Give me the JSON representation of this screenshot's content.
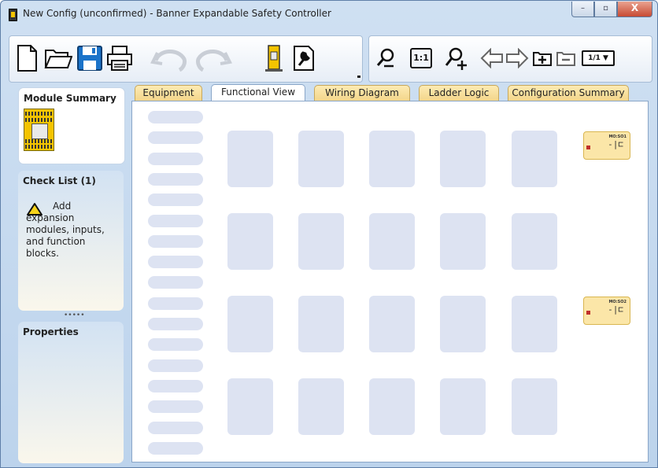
{
  "window": {
    "title": "New Config (unconfirmed) - Banner Expandable Safety Controller",
    "controls": {
      "minimize": "–",
      "maximize": "▫",
      "close": "X"
    }
  },
  "toolbar": {
    "zoom_actual_label": "1:1",
    "page_indicator": "1/1 ▼",
    "icons": [
      "new-file-icon",
      "open-folder-icon",
      "save-icon",
      "print-icon",
      "undo-icon",
      "redo-icon",
      "controller-icon",
      "wrench-icon",
      "zoom-out-icon",
      "zoom-actual-icon",
      "add-user-icon",
      "arrow-left-icon",
      "arrow-right-icon",
      "add-page-icon",
      "remove-page-icon",
      "page-selector"
    ]
  },
  "sidebar": {
    "module_summary_title": "Module Summary",
    "checklist_title": "Check List (1)",
    "checklist_item": "Add expansion modules, inputs, and function blocks.",
    "grip": "•••••",
    "properties_title": "Properties"
  },
  "tabs": [
    {
      "label": "Equipment",
      "active": false
    },
    {
      "label": "Functional View",
      "active": true
    },
    {
      "label": "Wiring Diagram",
      "active": false
    },
    {
      "label": "Ladder Logic",
      "active": false
    },
    {
      "label": "Configuration Summary",
      "active": false
    }
  ],
  "functional_view": {
    "outputs": [
      {
        "label": "MO:SO1",
        "symbol": "-|⊏"
      },
      {
        "label": "MO:SO2",
        "symbol": "-|⊏"
      }
    ]
  },
  "colors": {
    "tab_inactive": "#f3d58a",
    "slot": "#dde3f2",
    "output_block": "#fbe6a8"
  }
}
